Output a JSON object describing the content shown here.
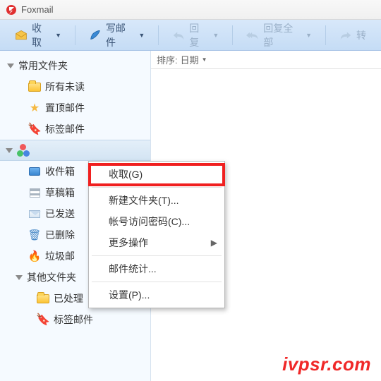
{
  "app": {
    "title": "Foxmail"
  },
  "toolbar": {
    "receive": "收取",
    "compose": "写邮件",
    "reply": "回复",
    "replyall": "回复全部",
    "forward": "转"
  },
  "sidebar": {
    "common_label": "常用文件夹",
    "unread": "所有未读",
    "pinned": "置顶邮件",
    "tagged": "标签邮件",
    "account_label": "",
    "inbox": "收件箱",
    "drafts": "草稿箱",
    "sent": "已发送",
    "deleted": "已删除",
    "junk": "垃圾邮",
    "other_label": "其他文件夹",
    "processed": "已处理",
    "tagged2": "标签邮件"
  },
  "content": {
    "sort_prefix": "排序:",
    "sort_by": "日期"
  },
  "context_menu": {
    "items": [
      {
        "label": "收取(G)",
        "sep_after": true
      },
      {
        "label": "新建文件夹(T)..."
      },
      {
        "label": "帐号访问密码(C)..."
      },
      {
        "label": "更多操作",
        "submenu": true,
        "sep_after": true
      },
      {
        "label": "邮件统计...",
        "sep_after": true
      },
      {
        "label": "设置(P)..."
      }
    ]
  },
  "watermark": "ivpsr.com"
}
